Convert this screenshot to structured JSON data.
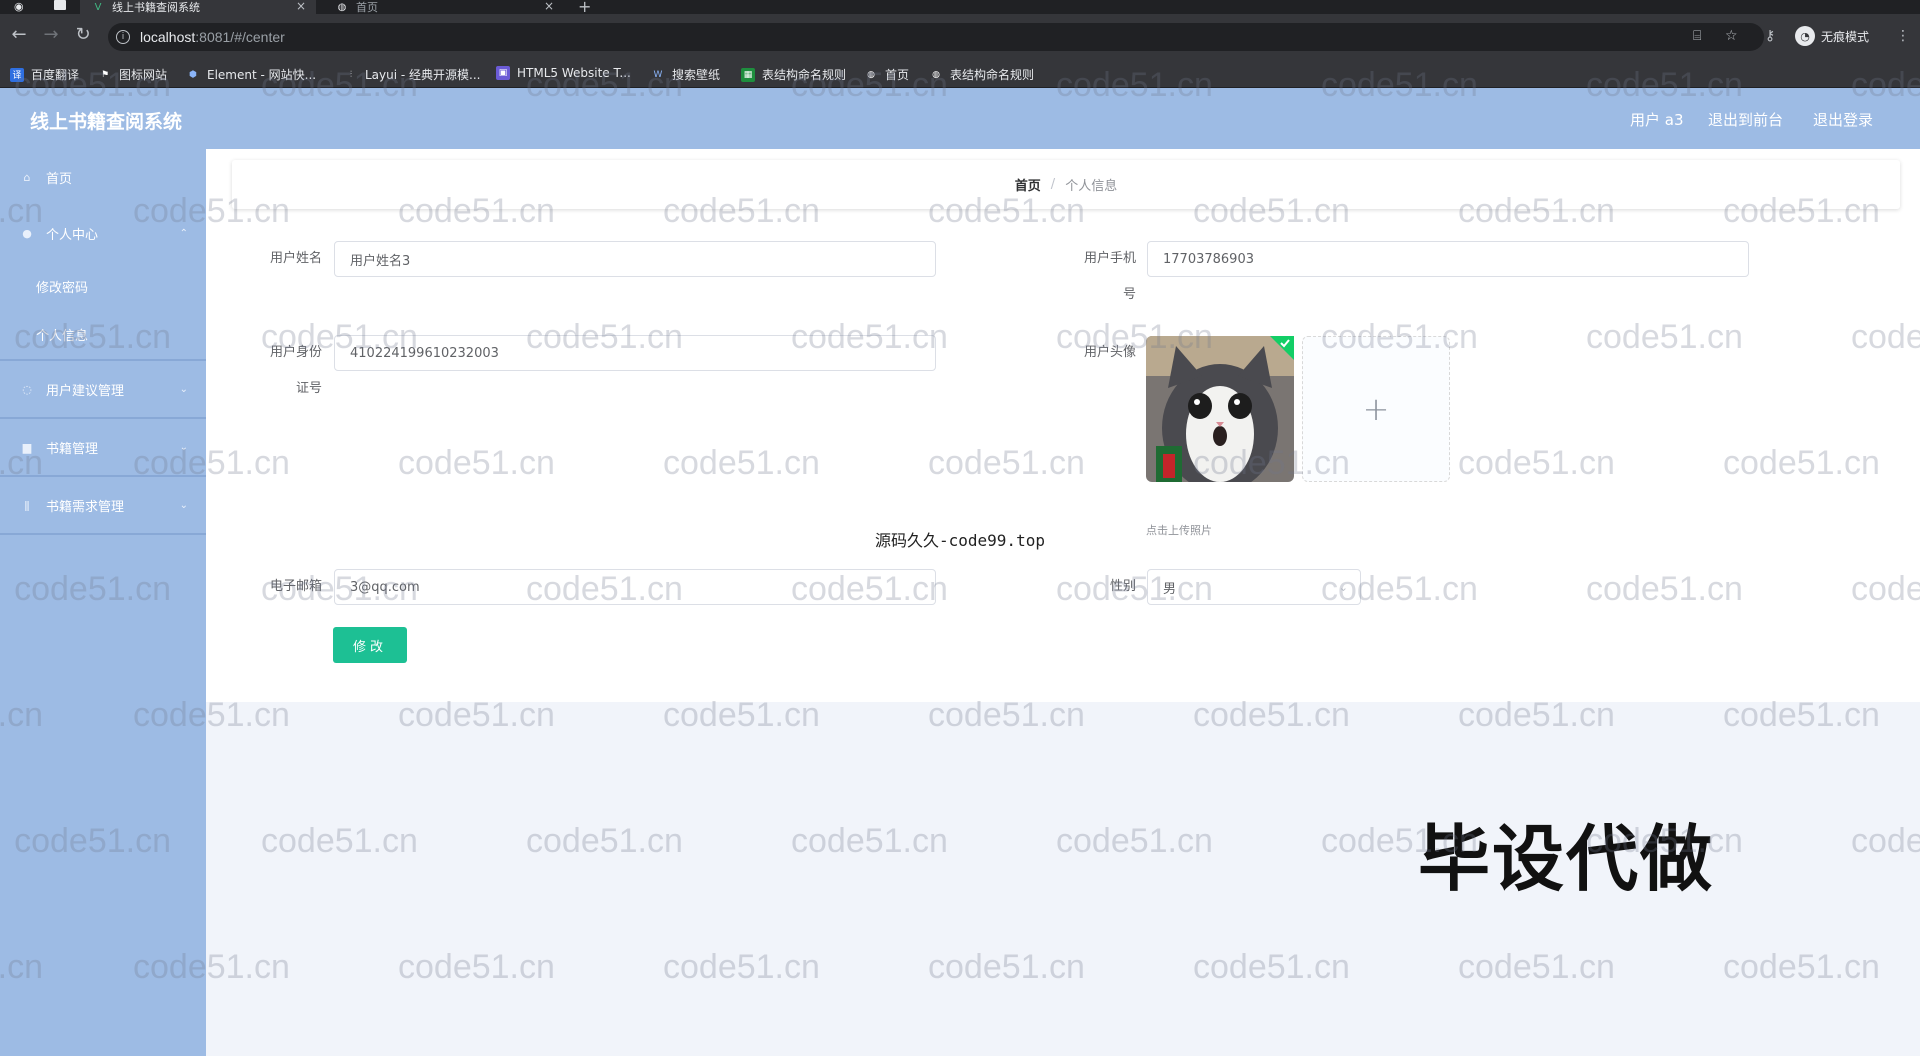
{
  "browser": {
    "tabs": [
      {
        "title": "线上书籍查阅系统",
        "icon": "vue-icon",
        "active": true
      },
      {
        "title": "首页",
        "icon": "globe-icon",
        "active": false
      }
    ],
    "url_host": "localhost",
    "url_rest": ":8081/#/center",
    "incognito_label": "无痕模式",
    "bookmarks": [
      "百度翻译",
      "图标网站",
      "Element - 网站快...",
      "Layui - 经典开源模...",
      "HTML5 Website T...",
      "搜索壁纸",
      "表结构命名规则",
      "首页",
      "表结构命名规则"
    ]
  },
  "header": {
    "title": "线上书籍查阅系统",
    "user": "用户 a3",
    "to_front": "退出到前台",
    "logout": "退出登录"
  },
  "sidebar": {
    "home": "首页",
    "personal_center": "个人中心",
    "change_password": "修改密码",
    "personal_info": "个人信息",
    "suggestion_mgmt": "用户建议管理",
    "book_mgmt": "书籍管理",
    "book_request_mgmt": "书籍需求管理"
  },
  "breadcrumb": {
    "home": "首页",
    "separator": "/",
    "current": "个人信息"
  },
  "form": {
    "name_label": "用户姓名",
    "name_value": "用户姓名3",
    "phone_label_1": "用户手机",
    "phone_label_2": "号",
    "phone_value": "17703786903",
    "idcard_label_1": "用户身份",
    "idcard_label_2": "证号",
    "idcard_value": "410224199610232003",
    "avatar_label": "用户头像",
    "upload_tip": "点击上传照片",
    "email_label": "电子邮箱",
    "email_value": "3@qq.com",
    "gender_label": "性别",
    "gender_value": "男",
    "submit": "修改"
  },
  "overlay": {
    "source_text": "源码久久-code99.top",
    "ad_text": "毕设代做",
    "watermark": "code51.cn"
  },
  "colors": {
    "theme": "#9dbbe4",
    "button": "#1dc094"
  }
}
